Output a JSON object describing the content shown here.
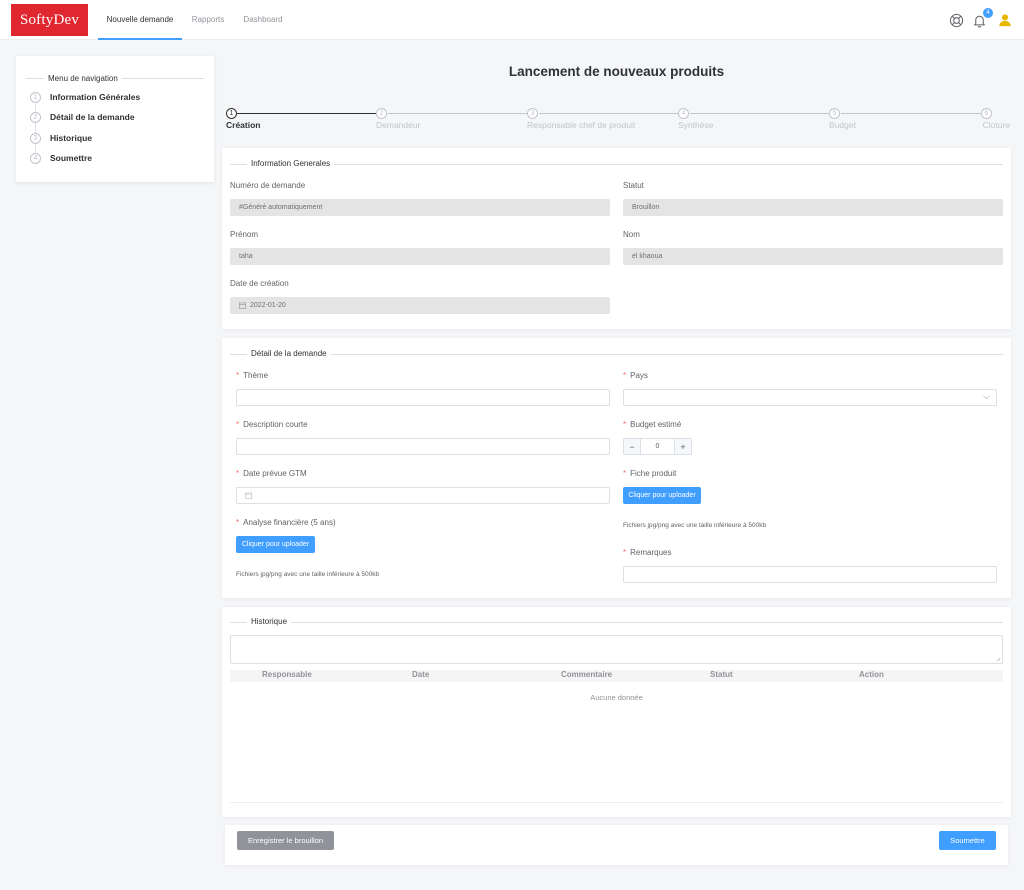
{
  "header": {
    "logo": "SoftyDev",
    "nav": [
      "Nouvelle demande",
      "Rapports",
      "Dashboard"
    ],
    "notification_count": "4",
    "icons": [
      "lifebuoy-icon",
      "bell-icon",
      "user-icon"
    ],
    "accent_color": "#409eff",
    "brand_color": "#e0262f"
  },
  "sidebar": {
    "title": "Menu de navigation",
    "items": [
      {
        "num": "1",
        "label": "Information Générales"
      },
      {
        "num": "2",
        "label": "Détail de la demande"
      },
      {
        "num": "3",
        "label": "Historique"
      },
      {
        "num": "4",
        "label": "Soumettre"
      }
    ]
  },
  "page_title": "Lancement de nouveaux produits",
  "steps": [
    {
      "num": "1",
      "label": "Création"
    },
    {
      "num": "2",
      "label": "Demandeur"
    },
    {
      "num": "3",
      "label": "Responsable chef de produit"
    },
    {
      "num": "4",
      "label": "Synthèse"
    },
    {
      "num": "5",
      "label": "Budget"
    },
    {
      "num": "6",
      "label": "Cloture"
    }
  ],
  "info": {
    "title": "Information Generales",
    "numero_label": "Numéro de demande",
    "numero_value": "#Généré automatiquement",
    "statut_label": "Statut",
    "statut_value": "Brouillon",
    "prenom_label": "Prénom",
    "prenom_value": "taha",
    "nom_label": "Nom",
    "nom_value": "el khaoua",
    "date_label": "Date de création",
    "date_value": "2022-01-20"
  },
  "detail": {
    "title": "Détail de la demande",
    "theme_label": "Thème",
    "pays_label": "Pays",
    "description_label": "Description courte",
    "budget_label": "Budget estimé",
    "budget_value": "0",
    "date_gtm_label": "Date prévue GTM",
    "fiche_label": "Fiche produit",
    "upload_label": "Cliquer pour uploader",
    "upload_hint": "Fichiers jpg/png avec une taille inférieure à 500kb",
    "analyse_label": "Analyse financière (5 ans)",
    "remarques_label": "Remarques",
    "required_mark": "*",
    "minus": "−",
    "plus": "+"
  },
  "historique": {
    "title": "Historique",
    "columns": [
      "Responsable",
      "Date",
      "Commentaire",
      "Statut",
      "Action"
    ],
    "empty": "Aucune donnée"
  },
  "footer": {
    "draft_label": "Enregistrer le brouillon",
    "submit_label": "Soumettre"
  }
}
